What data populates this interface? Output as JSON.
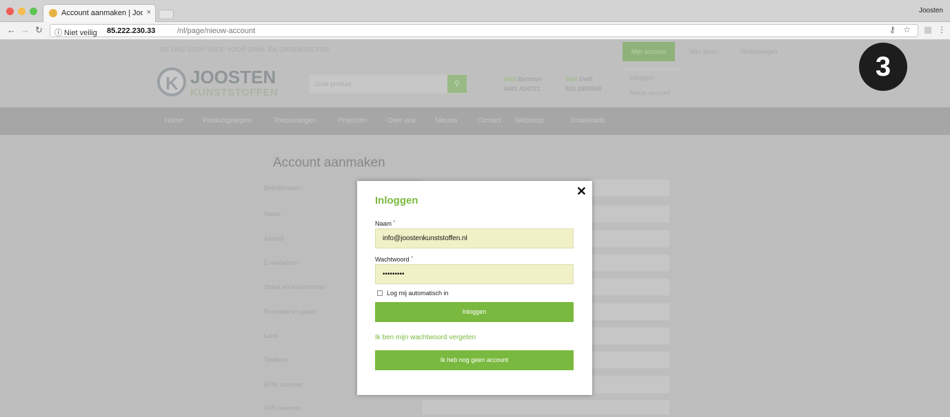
{
  "browser": {
    "tab_title": "Account aanmaken | Joosten",
    "tab_close": "×",
    "profile_name": "Joosten",
    "url_security": "ⓘ Niet veilig",
    "url_host": "85.222.230.33",
    "url_path": "/nl/page/nieuw-account",
    "traffic_colors": [
      "#ee5c55",
      "#f5bd4f",
      "#5fc454"
    ]
  },
  "site": {
    "tagline": "DE ONE-STOP-SHOP VOOR GWW- EN GROENSECTOR",
    "my_account": "Mijn account",
    "lists": "Mijn lijsten",
    "cart": "Winkelwagen",
    "logo_top": "JOOSTEN",
    "logo_bottom": "KUNSTSTOFFEN",
    "search_placeholder": "Zoek product",
    "offices": [
      {
        "prefix": "Mail",
        "city": "Bemmel",
        "phone": "0481 424721"
      },
      {
        "prefix": "Mail",
        "city": "Delft",
        "phone": "015 2855580"
      }
    ],
    "side_links": [
      "Inloggen",
      "Nieuw account"
    ],
    "menu": [
      "Home",
      "Productgroepen",
      "Toepassingen",
      "Projecten",
      "Over ons",
      "Nieuws",
      "Contact",
      "Webshop",
      "Downloads"
    ],
    "page_title": "Account aanmaken",
    "form_labels": [
      "Bedrijfsnaam",
      "Naam",
      "Aanhef",
      "E-mailadres",
      "Straat en huisnummer",
      "Postcode en plaats",
      "Land",
      "Telefoon",
      "BTW nummer",
      "KVK nummer"
    ]
  },
  "modal": {
    "close": "✕",
    "title": "Inloggen",
    "name_label": "Naam",
    "name_value": "info@joostenkunststoffen.nl",
    "password_label": "Wachtwoord",
    "password_value": "•••••••••",
    "required_mark": "*",
    "remember_label": "Log mij automatisch in",
    "login_button": "Inloggen",
    "forgot_link": "Ik ben mijn wachtwoord vergeten",
    "no_account_button": "Ik heb nog geen account"
  },
  "badge": "3",
  "colors": {
    "accent_green": "#7ab93f",
    "input_yellow": "#f1f1c8"
  }
}
